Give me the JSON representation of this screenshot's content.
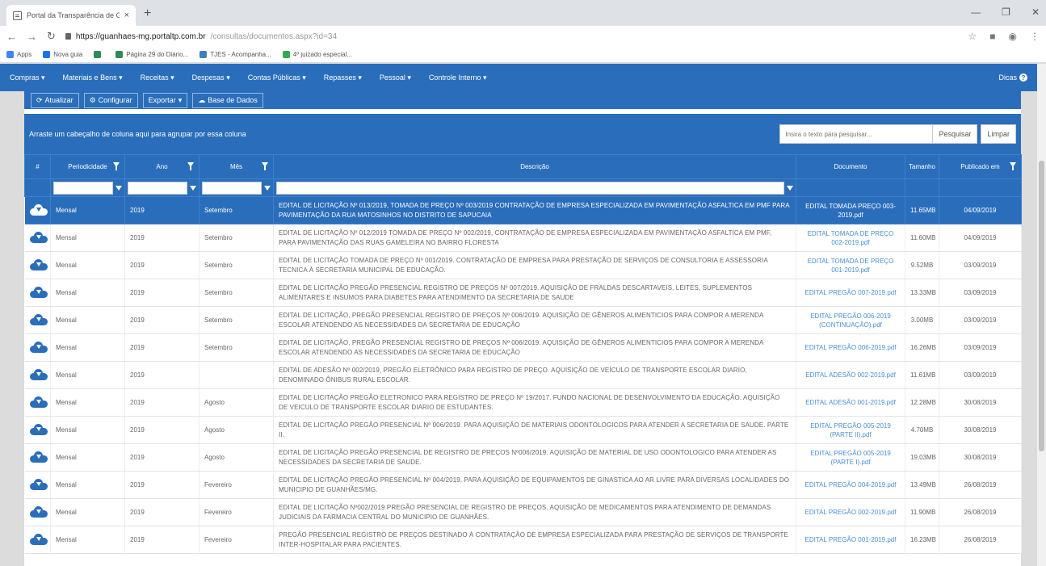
{
  "browser": {
    "tab_title": "Portal da Transparência de Guan",
    "tab_close": "×",
    "new_tab": "+",
    "url_host": "https://guanhaes-mg.portaltp.com.br",
    "url_path": "/consultas/documentos.aspx?id=34",
    "bookmarks": [
      {
        "label": "Apps",
        "color": "#4285f4"
      },
      {
        "label": "Nova guia",
        "color": "#1a73e8"
      },
      {
        "label": "",
        "color": "#2e8b57"
      },
      {
        "label": "Página 29 do Diário...",
        "color": "#2e8b57"
      },
      {
        "label": "TJES - Acompanha...",
        "color": "#3f7fbf"
      },
      {
        "label": "4º juizado especial...",
        "color": "#34a853"
      }
    ]
  },
  "nav": {
    "items": [
      "Compras",
      "Materiais e Bens",
      "Receitas",
      "Despesas",
      "Contas Públicas",
      "Repasses",
      "Pessoal",
      "Controle Interno"
    ],
    "help": "Dicas"
  },
  "toolbar": {
    "refresh": "Atualizar",
    "configure": "Configurar",
    "export": "Exportar",
    "database": "Base de Dados"
  },
  "group": {
    "hint": "Arraste um cabeçalho de coluna aqui para agrupar por essa coluna",
    "search_placeholder": "Insira o texto para pesquisar...",
    "search_label": "Pesquisar",
    "clear_label": "Limpar"
  },
  "columns": {
    "num": "#",
    "periodicidade": "Periodicidade",
    "ano": "Ano",
    "mes": "Mês",
    "descricao": "Descrição",
    "documento": "Documento",
    "tamanho": "Tamanho",
    "publicado": "Publicado em"
  },
  "rows": [
    {
      "per": "Mensal",
      "ano": "2019",
      "mes": "Setembro",
      "desc": "EDITAL DE LICITAÇÃO Nº 013/2019, TOMADA DE PREÇO Nº 003/2019 CONTRATAÇÃO DE EMPRESA ESPECIALIZADA EM PAVIMENTAÇÃO ASFALTICA EM PMF PARA PAVIMENTAÇÃO DA RUA MATOSINHOS NO DISTRITO DE SAPUCAIA",
      "doc": "EDITAL TOMADA PREÇO 003-2019.pdf",
      "size": "11.65MB",
      "date": "04/09/2019",
      "selected": true
    },
    {
      "per": "Mensal",
      "ano": "2019",
      "mes": "Setembro",
      "desc": "EDITAL DE LICITAÇÃO Nº 012/2019 TOMADA DE PREÇO Nº 002/2019, CONTRATAÇÃO DE EMPRESA ESPECIALIZADA EM PAVIMENTAÇÃO ASFALTICA EM PMF, PARA PAVIMENTAÇÃO DAS RUAS GAMELEIRA NO BAIRRO FLORESTA",
      "doc": "EDITAL TOMADA DE PREÇO 002-2019.pdf",
      "size": "11.60MB",
      "date": "04/09/2019"
    },
    {
      "per": "Mensal",
      "ano": "2019",
      "mes": "Setembro",
      "desc": "EDITAL DE LICITAÇÃO TOMADA DE PREÇO Nº 001/2019. CONTRATAÇÃO DE EMPRESA PARA PRESTAÇÃO DE SERVIÇOS DE CONSULTORIA E ASSESSORIA TECNICA À SECRETARIA MUNICIPAL DE EDUCAÇÃO.",
      "doc": "EDITAL TOMADA DE PREÇO 001-2019.pdf",
      "size": "9.52MB",
      "date": "03/09/2019"
    },
    {
      "per": "Mensal",
      "ano": "2019",
      "mes": "Setembro",
      "desc": "EDITAL DE LICITAÇÃO PREGÃO PRESENCIAL REGISTRO DE PREÇOS Nº 007/2019. AQUISIÇÃO DE FRALDAS DESCARTAVEIS, LEITES, SUPLEMENTOS ALIMENTARES E INSUMOS PARA DIABETES PARA ATENDIMENTO DA SECRETARIA DE SAUDE",
      "doc": "EDITAL PREGÃO 007-2019.pdf",
      "size": "13.33MB",
      "date": "03/09/2019"
    },
    {
      "per": "Mensal",
      "ano": "2019",
      "mes": "Setembro",
      "desc": "EDITAL DE LICITAÇÃO, PREGÃO PRESENCIAL REGISTRO DE PREÇOS Nº 006/2019. AQUISIÇÃO DE GÊNEROS ALIMENTICIOS PARA COMPOR A MERENDA ESCOLAR ATENDENDO AS NECESSIDADES DA SECRETARIA DE EDUCAÇÃO",
      "doc": "EDITAL PREGÃO 006-2019 (CONTINUAÇÃO).pdf",
      "size": "3.00MB",
      "date": "03/09/2019"
    },
    {
      "per": "Mensal",
      "ano": "2019",
      "mes": "Setembro",
      "desc": "EDITAL DE LICITAÇÃO, PREGÃO PRESENCIAL REGISTRO DE PREÇOS Nº 006/2019. AQUISIÇÃO DE GÊNEROS ALIMENTICIOS PARA COMPOR A MERENDA ESCOLAR ATENDENDO AS NECESSIDADES DA SECRETARIA DE EDUCAÇÃO",
      "doc": "EDITAL PREGÃO 006-2019.pdf",
      "size": "16.26MB",
      "date": "03/09/2019"
    },
    {
      "per": "Mensal",
      "ano": "2019",
      "mes": "",
      "desc": "EDITAL DE ADESÃO Nº 002/2019, PREGÃO ELETRÔNICO PARA REGISTRO DE PREÇO. AQUISIÇÃO DE VEÍCULO DE TRANSPORTE ESCOLAR DIARIO, DENOMINADO ÔNIBUS RURAL ESCOLAR.",
      "doc": "EDITAL ADESÃO 002-2019.pdf",
      "size": "11.61MB",
      "date": "03/09/2019"
    },
    {
      "per": "Mensal",
      "ano": "2019",
      "mes": "Agosto",
      "desc": "EDITAL DE LICITAÇÃO PREGÃO ELETRONICO PARA REGISTRO DE PREÇO Nº 19/2017. FUNDO NACIONAL DE DESENVOLVIMENTO DA EDUCAÇÃO. AQUISIÇÃO DE VEICULO DE TRANSPORTE ESCOLAR DIARIO DE ESTUDANTES.",
      "doc": "EDITAL ADESÃO 001-2019.pdf",
      "size": "12.28MB",
      "date": "30/08/2019"
    },
    {
      "per": "Mensal",
      "ano": "2019",
      "mes": "Agosto",
      "desc": "EDITAL DE LICITAÇÃO PREGÃO PRESENCIAL Nº 006/2019. PARA AQUISIÇÃO DE MATERIAIS ODONTOLOGICOS PARA ATENDER A SECRETARIA DE SAUDE. PARTE II.",
      "doc": "EDITAL PREGÃO 005-2019 (PARTE II).pdf",
      "size": "4.70MB",
      "date": "30/08/2019"
    },
    {
      "per": "Mensal",
      "ano": "2019",
      "mes": "Agosto",
      "desc": "EDITAL DE LICITAÇÃO PREGÃO PRESENCIAL DE REGISTRO DE PREÇOS Nº006/2019. AQUISIÇÃO DE MATERIAL DE USO ODONTOLOGICO PARA ATENDER AS NECESSIDADES DA SECRETARIA DE SAUDE.",
      "doc": "EDITAL PREGÃO 005-2019 (PARTE I).pdf",
      "size": "19.03MB",
      "date": "30/08/2019"
    },
    {
      "per": "Mensal",
      "ano": "2019",
      "mes": "Fevereiro",
      "desc": "EDITAL DE LICITAÇÃO PREGÃO PRESENCIAL Nº 004/2019, PARA AQUISIÇÃO DE EQUIPAMENTOS DE GINASTICA AO AR LIVRE PARA DIVERSAS LOCALIDADES DO MUNICIPIO DE GUANHÃES/MG.",
      "doc": "EDITAL PREGÃO 004-2019.pdf",
      "size": "13.49MB",
      "date": "26/08/2019"
    },
    {
      "per": "Mensal",
      "ano": "2019",
      "mes": "Fevereiro",
      "desc": "EDITAL DE LICITAÇÃO Nº002/2019 PREGÃO PRESENCIAL DE REGISTRO DE PREÇOS. AQUISIÇÃO DE MEDICAMENTOS PARA ATENDIMENTO DE DEMANDAS JUDICIAIS DA FARMACIA CENTRAL DO MUNICIPIO DE GUANHÃES.",
      "doc": "EDITAL PREGÃO 002-2019.pdf",
      "size": "11.90MB",
      "date": "26/08/2019"
    },
    {
      "per": "Mensal",
      "ano": "2019",
      "mes": "Fevereiro",
      "desc": "PREGÃO PRESENCIAL REGISTRO DE PREÇOS DESTINADO À CONTRATAÇÃO DE EMPRESA ESPECIALIZADA PARA PRESTAÇÃO DE SERVIÇOS DE TRANSPORTE INTER-HOSPITALAR PARA PACIENTES.",
      "doc": "EDITAL PREGÃO 001-2019.pdf",
      "size": "16.23MB",
      "date": "26/08/2019"
    }
  ],
  "colors": {
    "accent": "#2a6ebb",
    "link": "#4a8fd6"
  }
}
